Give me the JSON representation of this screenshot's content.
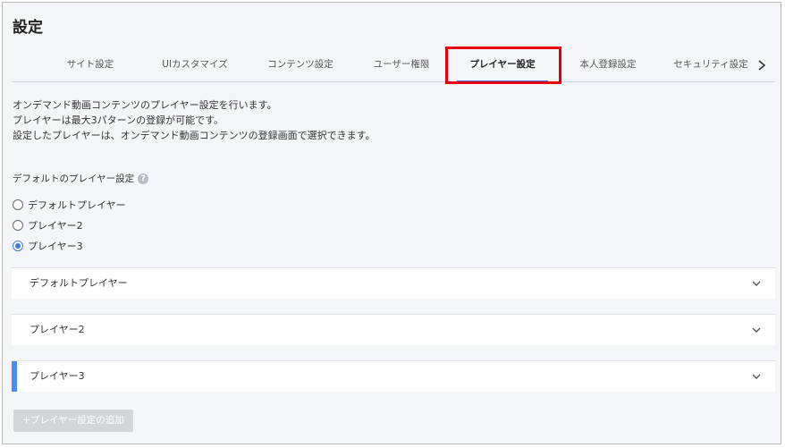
{
  "page": {
    "title": "設定"
  },
  "tabs": [
    {
      "label": "サイト設定",
      "active": false
    },
    {
      "label": "UIカスタマイズ",
      "active": false
    },
    {
      "label": "コンテンツ設定",
      "active": false
    },
    {
      "label": "ユーザー権限",
      "active": false
    },
    {
      "label": "プレイヤー設定",
      "active": true
    },
    {
      "label": "本人登録設定",
      "active": false
    },
    {
      "label": "セキュリティ設定",
      "active": false
    }
  ],
  "description": [
    "オンデマンド動画コンテンツのプレイヤー設定を行います。",
    "プレイヤーは最大3パターンの登録が可能です。",
    "設定したプレイヤーは、オンデマンド動画コンテンツの登録画面で選択できます。"
  ],
  "default_player": {
    "label": "デフォルトのプレイヤー設定",
    "help_icon": "question-icon",
    "help_glyph": "?",
    "options": [
      {
        "label": "デフォルトプレイヤー",
        "checked": false
      },
      {
        "label": "プレイヤー2",
        "checked": false
      },
      {
        "label": "プレイヤー3",
        "checked": true
      }
    ]
  },
  "panels": [
    {
      "label": "デフォルトプレイヤー"
    },
    {
      "label": "プレイヤー2"
    },
    {
      "label": "プレイヤー3"
    }
  ],
  "add_button": {
    "label": "+プレイヤー設定の追加"
  },
  "colors": {
    "accent": "#3f7bdc",
    "highlight": "#e60012",
    "panel_marker": "#4a8af4"
  }
}
